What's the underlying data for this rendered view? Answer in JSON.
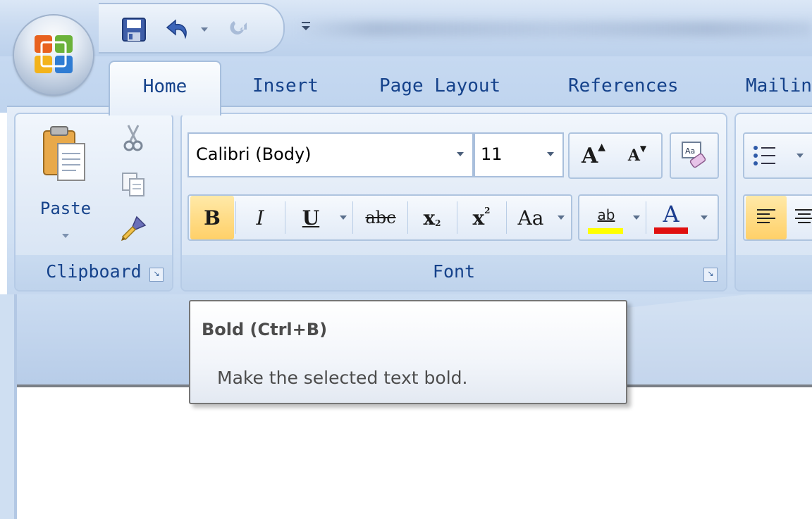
{
  "tabs": [
    {
      "label": "Home",
      "active": true
    },
    {
      "label": "Insert"
    },
    {
      "label": "Page Layout"
    },
    {
      "label": "References"
    },
    {
      "label": "Mailin"
    }
  ],
  "quick_access": {
    "save_icon": "save-icon",
    "undo_icon": "undo-icon",
    "redo_icon": "redo-icon",
    "customize_icon": "customize-qat-icon"
  },
  "clipboard": {
    "group_label": "Clipboard",
    "paste_label": "Paste",
    "cut_icon": "scissors-icon",
    "copy_icon": "copy-icon",
    "format_painter_icon": "format-painter-icon"
  },
  "font": {
    "group_label": "Font",
    "font_name": "Calibri (Body)",
    "font_size": "11",
    "grow_label": "A",
    "shrink_label": "A",
    "bold_label": "B",
    "italic_label": "I",
    "underline_label": "U",
    "strike_label": "abc",
    "subscript_label": "x",
    "subscript_mark": "2",
    "superscript_label": "x",
    "superscript_mark": "2",
    "change_case_label": "Aa",
    "highlight_label": "ab",
    "font_color_label": "A",
    "highlight_color": "#ffff00",
    "font_color": "#e01010"
  },
  "tooltip": {
    "title": "Bold (Ctrl+B)",
    "description": "Make the selected text bold."
  },
  "colors": {
    "accent": "#15428b",
    "active_button": "#ffd86b"
  }
}
